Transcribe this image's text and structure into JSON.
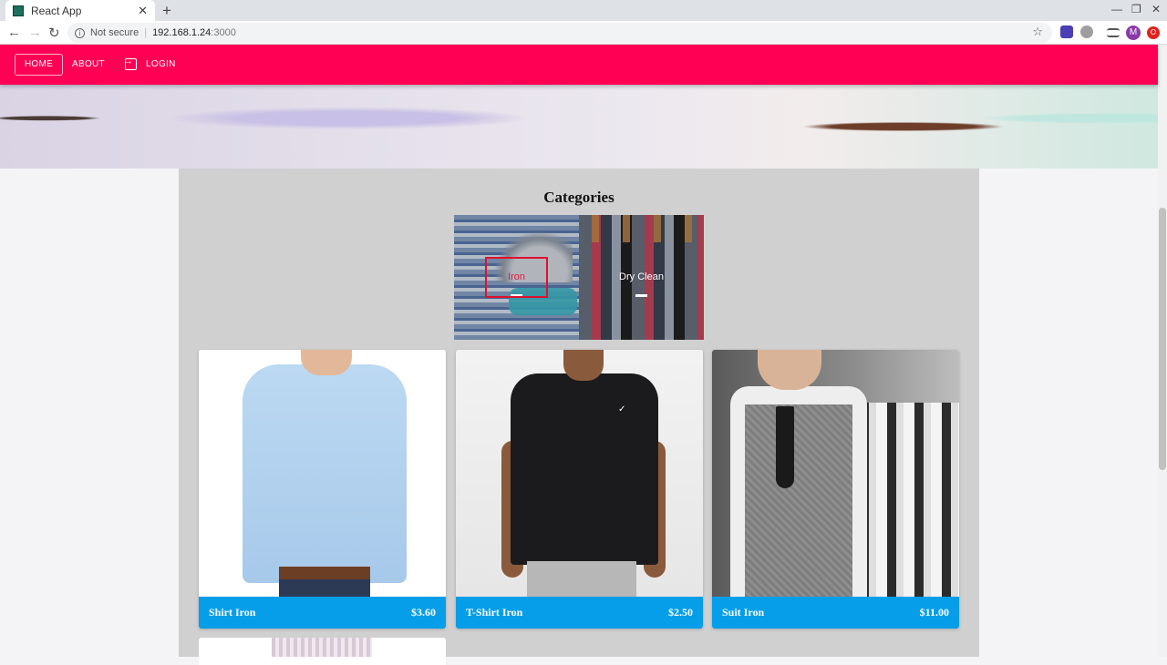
{
  "browser": {
    "tab_title": "React App",
    "tab_close": "✕",
    "new_tab": "+",
    "window_controls": [
      "—",
      "❐",
      "✕"
    ],
    "security_label": "Not secure",
    "url_host": "192.168.1.24",
    "url_port": ":3000",
    "profile_initial": "M",
    "icons": [
      "back-icon",
      "forward-icon",
      "reload-icon",
      "info-icon",
      "star-icon",
      "extension-icon",
      "reading-list-icon",
      "opera-icon"
    ]
  },
  "nav": {
    "home_label": "HOME",
    "about_label": "ABOUT",
    "login_label": "LOGIN",
    "accent_color": "#ff0055"
  },
  "categories": {
    "title": "Categories",
    "items": [
      {
        "label": "Iron"
      },
      {
        "label": "Dry Clean"
      }
    ]
  },
  "products": [
    {
      "name": "Shirt Iron",
      "price": "$3.60"
    },
    {
      "name": "T-Shirt Iron",
      "price": "$2.50"
    },
    {
      "name": "Suit Iron",
      "price": "$11.00"
    }
  ],
  "colors": {
    "footer": "#069ee8",
    "container": "#d0d0d0"
  }
}
